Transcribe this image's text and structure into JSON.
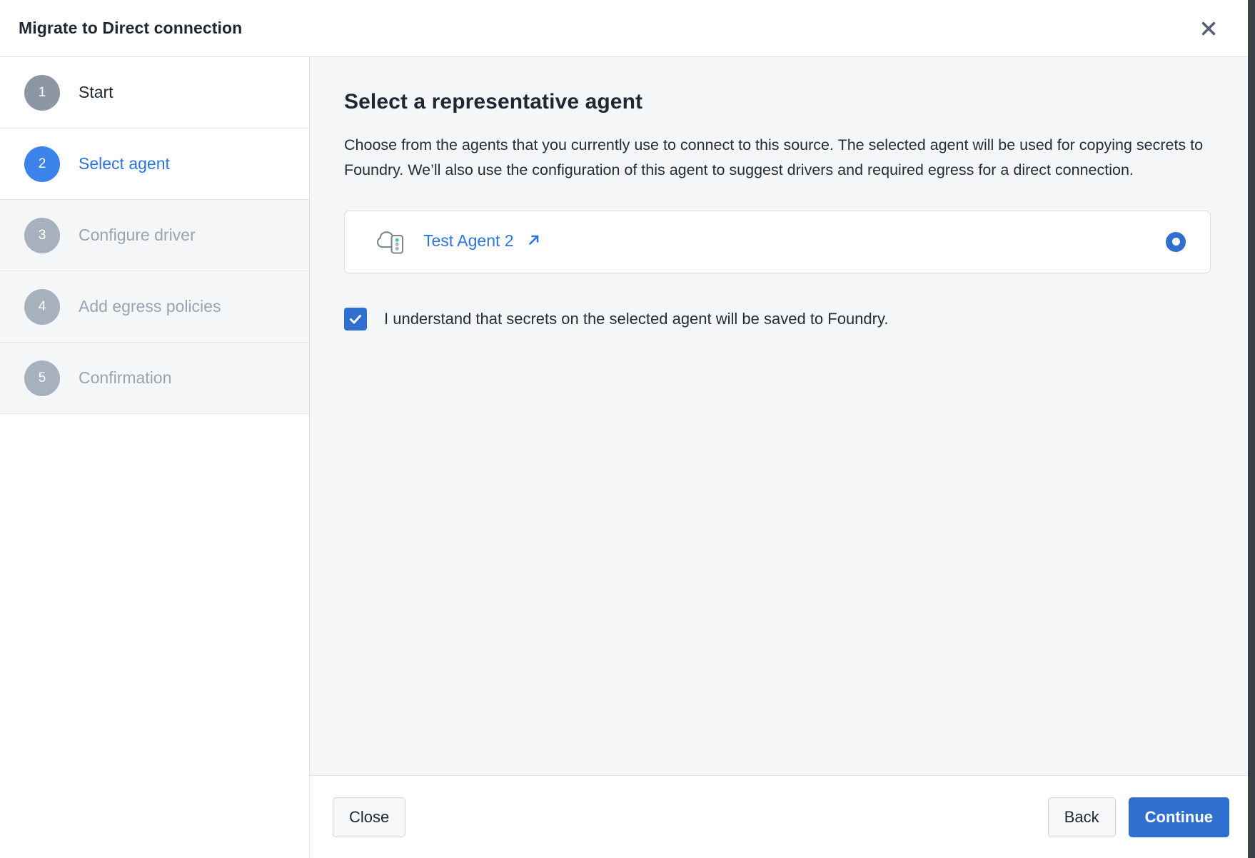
{
  "header": {
    "title": "Migrate to Direct connection",
    "close_icon": "close-icon"
  },
  "sidebar": {
    "steps": [
      {
        "number": "1",
        "label": "Start",
        "state": "completed"
      },
      {
        "number": "2",
        "label": "Select agent",
        "state": "current"
      },
      {
        "number": "3",
        "label": "Configure driver",
        "state": "inactive"
      },
      {
        "number": "4",
        "label": "Add egress policies",
        "state": "inactive"
      },
      {
        "number": "5",
        "label": "Confirmation",
        "state": "inactive"
      }
    ]
  },
  "main": {
    "title": "Select a representative agent",
    "description": "Choose from the agents that you currently use to connect to this source. The selected agent will be used for copying secrets to Foundry. We’ll also use the configuration of this agent to suggest drivers and required egress for a direct connection.",
    "agent": {
      "name": "Test Agent 2",
      "icon": "cloud-agent-icon",
      "external_link_icon": "external-link-icon",
      "selected": true,
      "radio_name": "agent-radio"
    },
    "consent": {
      "label": "I understand that secrets on the selected agent will be saved to Foundry.",
      "checked": true
    }
  },
  "footer": {
    "close_label": "Close",
    "back_label": "Back",
    "continue_label": "Continue"
  },
  "colors": {
    "accent_blue": "#2f6fd0",
    "step_current_blue": "#3b82ea",
    "link_blue": "#2e74dd",
    "step_gray": "#8d96a3",
    "content_bg": "#f4f6f8",
    "status_green": "#3ecf8e"
  }
}
